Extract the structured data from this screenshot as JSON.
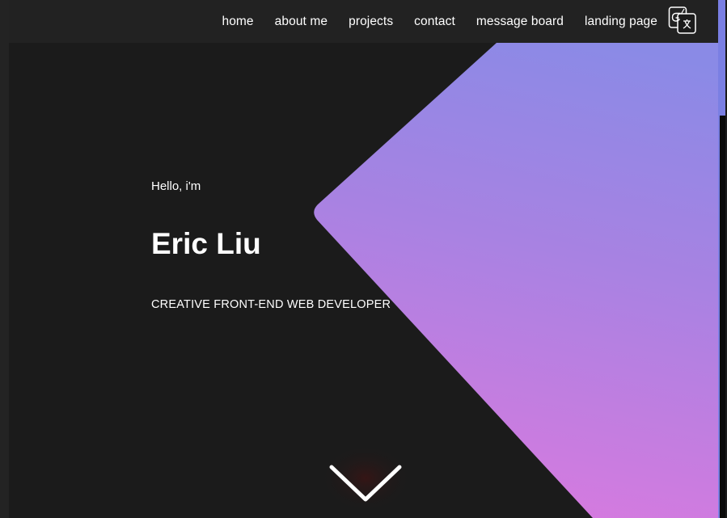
{
  "nav": {
    "links": [
      {
        "label": "home"
      },
      {
        "label": "about me"
      },
      {
        "label": "projects"
      },
      {
        "label": "contact"
      },
      {
        "label": "message board"
      },
      {
        "label": "landing page"
      }
    ],
    "translate_icon": "google-translate-icon"
  },
  "hero": {
    "greeting": "Hello, i'm",
    "name": "Eric Liu",
    "subtitle": "CREATIVE FRONT-END WEB DEVELOPER",
    "scroll_icon": "chevron-down-icon"
  },
  "colors": {
    "background": "#1b1b1b",
    "navbar": "#222222",
    "gradient_top": "#8a8ae6",
    "gradient_bottom": "#d67adf",
    "accent": "#7a7fe3"
  }
}
